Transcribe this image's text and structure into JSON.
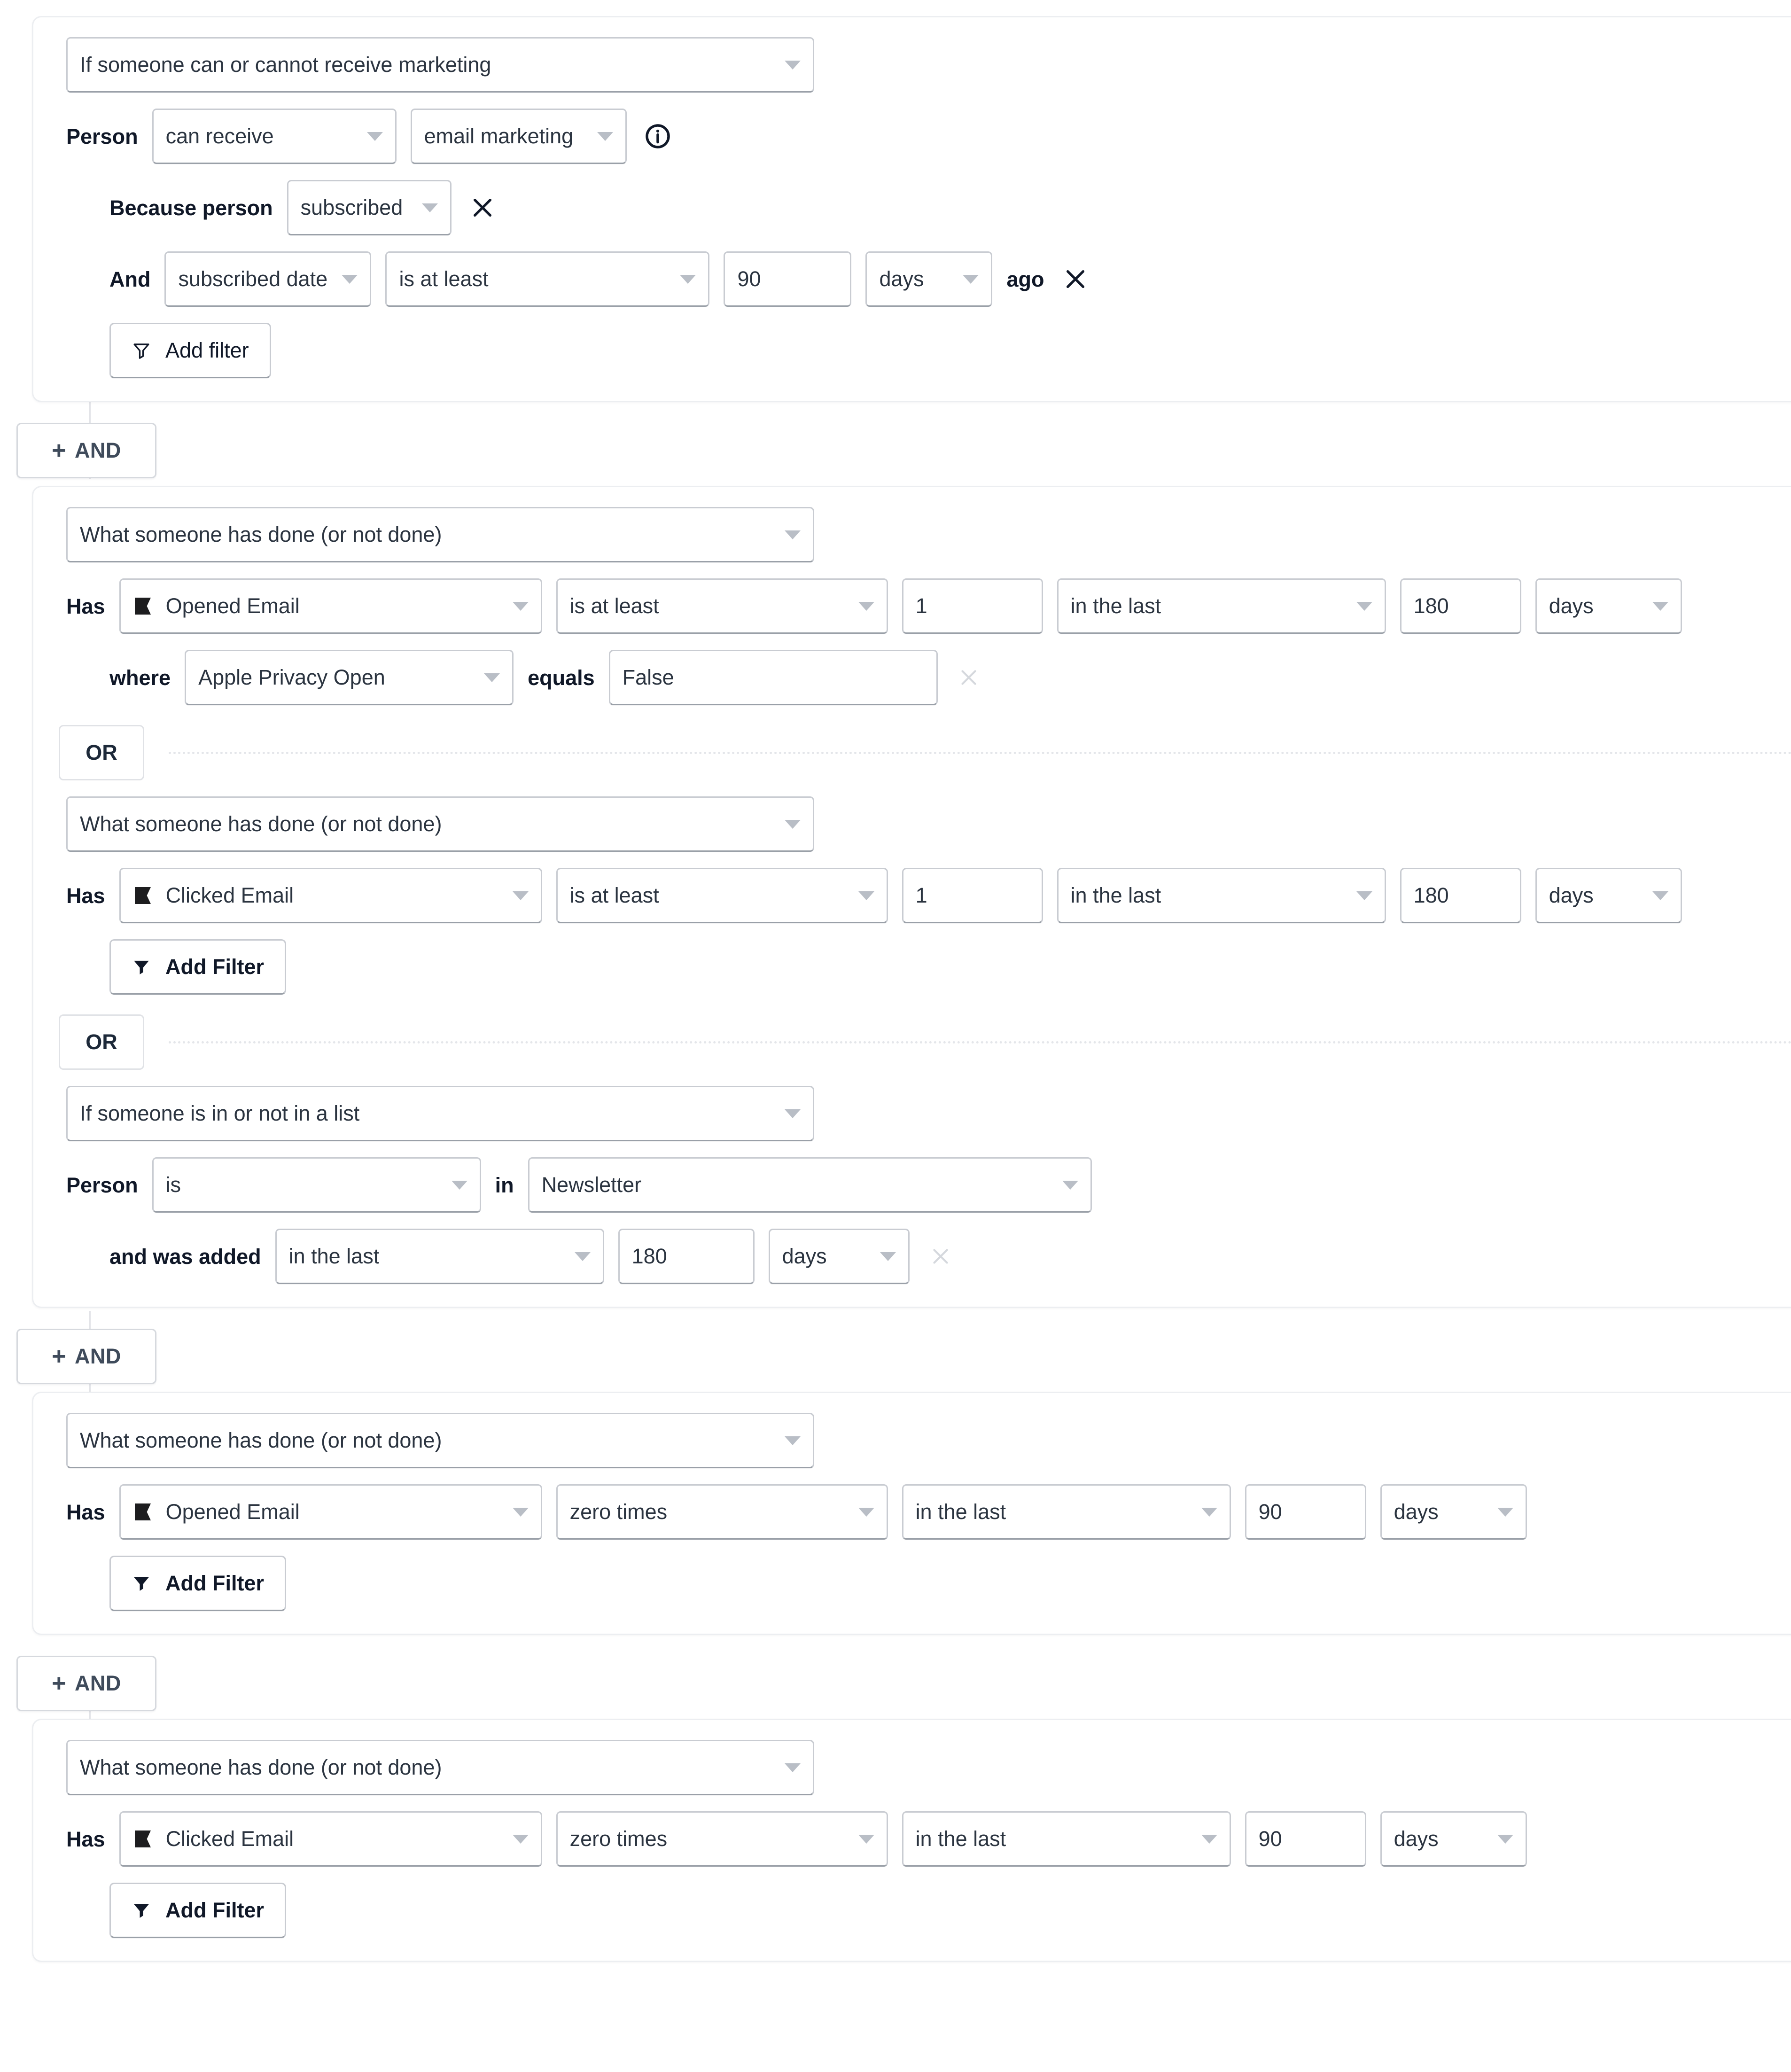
{
  "theme": {
    "accent_and": "#3f4b5b",
    "border": "#c9ccd2",
    "card_border": "#eceef1",
    "text": "#101828",
    "muted": "#b9bec6"
  },
  "groups": [
    {
      "id": "group-marketing",
      "type_select": "If someone can or cannot receive marketing",
      "rows": [
        {
          "id": "person-can-receive",
          "label": "Person",
          "can_receive": "can receive",
          "channel": "email marketing",
          "info": "info-icon"
        },
        {
          "id": "because-person",
          "label": "Because person",
          "reason": "subscribed"
        },
        {
          "id": "and-subscribed-date",
          "label": "And",
          "field": "subscribed date",
          "operator": "is at least",
          "value": "90",
          "unit": "days",
          "suffix": "ago"
        }
      ],
      "add_filter_label": "Add filter"
    },
    {
      "id": "group-engaged",
      "blocks": [
        {
          "id": "opened-email-180",
          "type_select": "What someone has done (or not done)",
          "has_label": "Has",
          "metric": "Opened Email",
          "operator": "is at least",
          "count": "1",
          "timeframe": "in the last",
          "window_value": "180",
          "window_unit": "days",
          "where_label": "where",
          "where_field": "Apple Privacy Open",
          "equals_label": "equals",
          "equals_value": "False"
        },
        {
          "id": "clicked-email-180",
          "or_label": "OR",
          "type_select": "What someone has done (or not done)",
          "has_label": "Has",
          "metric": "Clicked Email",
          "operator": "is at least",
          "count": "1",
          "timeframe": "in the last",
          "window_value": "180",
          "window_unit": "days",
          "add_filter_label": "Add Filter"
        },
        {
          "id": "in-list-newsletter",
          "or_label": "OR",
          "type_select": "If someone is in or not in a list",
          "person_label": "Person",
          "is_value": "is",
          "in_label": "in",
          "list_name": "Newsletter",
          "added_label": "and was added",
          "added_timeframe": "in the last",
          "added_value": "180",
          "added_unit": "days"
        }
      ]
    },
    {
      "id": "group-not-opened",
      "type_select": "What someone has done (or not done)",
      "has_label": "Has",
      "metric": "Opened Email",
      "operator": "zero times",
      "timeframe": "in the last",
      "window_value": "90",
      "window_unit": "days",
      "add_filter_label": "Add Filter"
    },
    {
      "id": "group-not-clicked",
      "type_select": "What someone has done (or not done)",
      "has_label": "Has",
      "metric": "Clicked Email",
      "operator": "zero times",
      "timeframe": "in the last",
      "window_value": "90",
      "window_unit": "days",
      "add_filter_label": "Add Filter"
    }
  ],
  "and_buttons": [
    {
      "id": "and-1",
      "label": "AND",
      "plus": "+"
    },
    {
      "id": "and-2",
      "label": "AND",
      "plus": "+"
    },
    {
      "id": "and-3",
      "label": "AND",
      "plus": "+"
    }
  ]
}
